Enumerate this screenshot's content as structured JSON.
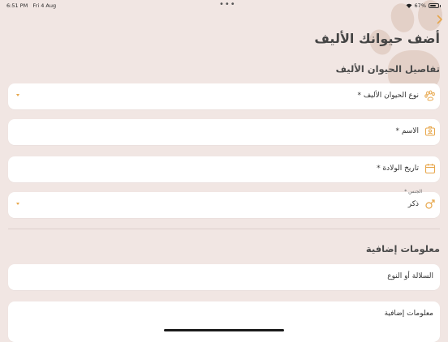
{
  "status": {
    "time": "6:51 PM",
    "date": "Fri 4 Aug",
    "battery": "67%"
  },
  "page": {
    "title": "أضف حيوانك الأليف",
    "back_icon": "chevron-right-icon"
  },
  "sections": {
    "details": "تفاصيل الحيوان الأليف",
    "extra": "معلومات إضافية"
  },
  "fields": {
    "pet_type": {
      "label": "نوع الحيوان الأليف *",
      "icon": "paw-icon"
    },
    "name": {
      "label": "الاسم *",
      "icon": "id-card-icon"
    },
    "birth": {
      "label": "تاريخ الولادة *",
      "icon": "calendar-icon"
    },
    "gender": {
      "label": "الجنس *",
      "value": "ذكر",
      "icon": "male-icon"
    },
    "breed": {
      "placeholder": "السلالة أو النوع"
    },
    "info": {
      "placeholder": "معلومات إضافية"
    }
  },
  "colors": {
    "accent": "#e7a64a",
    "background": "#f1e6e3"
  }
}
